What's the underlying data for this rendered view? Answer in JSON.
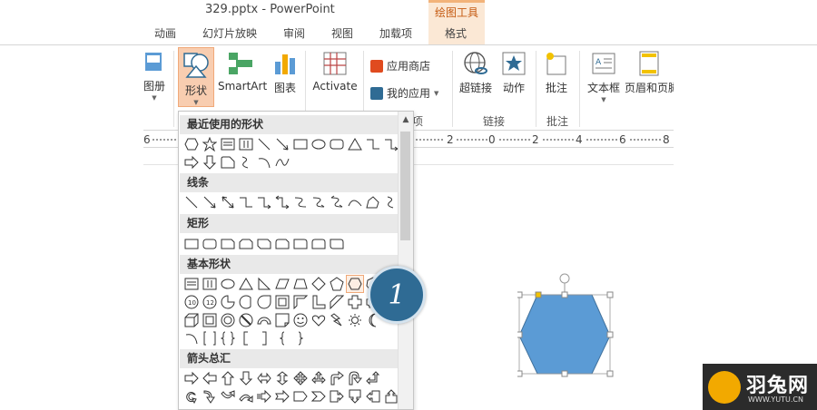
{
  "window": {
    "title": "329.pptx - PowerPoint"
  },
  "contextual_tab": {
    "group_label": "绘图工具"
  },
  "tabs": [
    "动画",
    "幻灯片放映",
    "审阅",
    "视图",
    "加载项",
    "格式"
  ],
  "ribbon": {
    "cut_label": "图册",
    "shapes_label": "形状",
    "smartart_label": "SmartArt",
    "chart_label": "图表",
    "activate_label": "Activate",
    "app_store_label": "应用商店",
    "my_apps_label": "我的应用",
    "addins_group_label": "项",
    "hyperlink_label": "超链接",
    "action_label": "动作",
    "links_group_label": "链接",
    "comment_label": "批注",
    "comments_group_label": "批注",
    "textbox_label": "文本框",
    "header_footer_label": "页眉和页脚"
  },
  "ruler": {
    "labels": [
      "6",
      "2",
      "0",
      "2",
      "4",
      "6",
      "8"
    ]
  },
  "gallery": {
    "recent_label": "最近使用的形状",
    "lines_label": "线条",
    "rect_label": "矩形",
    "basic_label": "基本形状",
    "arrows_label": "箭头总汇"
  },
  "step_badge": {
    "number": "1"
  },
  "watermark": {
    "cn": "羽兔网",
    "en": "WWW.YUTU.CN"
  },
  "colors": {
    "accent": "#f0a979",
    "shape_fill": "#5b9bd5",
    "badge": "#2f6b94"
  }
}
